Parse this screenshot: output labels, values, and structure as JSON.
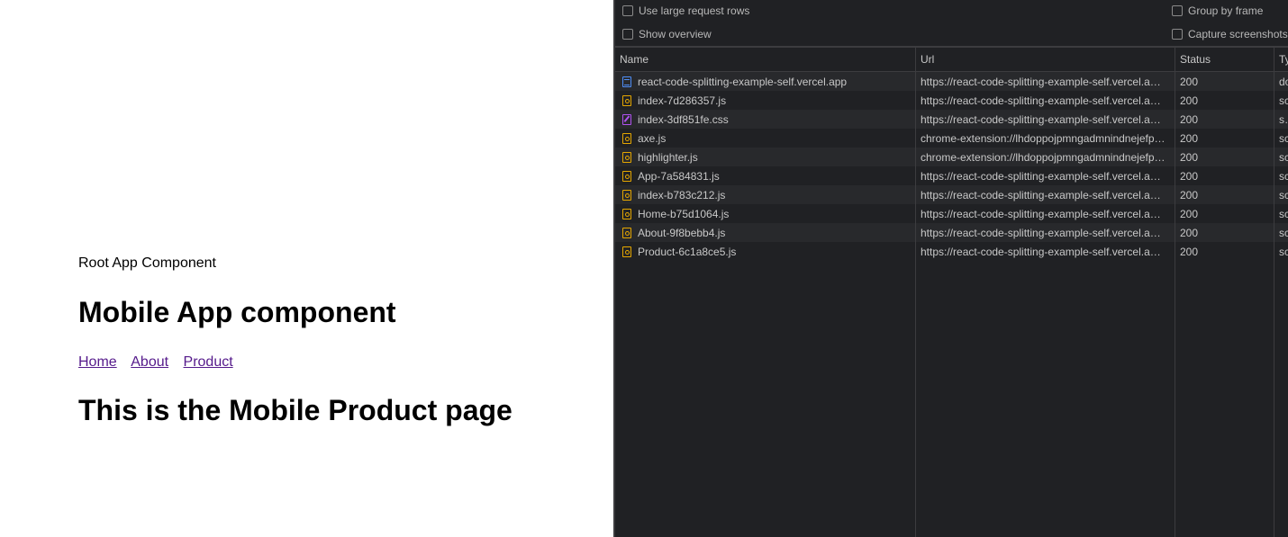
{
  "page": {
    "root_text": "Root App Component",
    "heading": "Mobile App component",
    "nav_links": [
      "Home",
      "About",
      "Product"
    ],
    "page_heading": "This is the Mobile Product page"
  },
  "devtools": {
    "options": {
      "large_rows": "Use large request rows",
      "show_overview": "Show overview",
      "group_by_frame": "Group by frame",
      "capture_screenshots": "Capture screenshots"
    },
    "columns": {
      "name": "Name",
      "url": "Url",
      "status": "Status",
      "type": "Ty"
    },
    "rows": [
      {
        "icon": "doc",
        "name": "react-code-splitting-example-self.vercel.app",
        "url": "https://react-code-splitting-example-self.vercel.a…",
        "status": "200",
        "type": "do"
      },
      {
        "icon": "js",
        "name": "index-7d286357.js",
        "url": "https://react-code-splitting-example-self.vercel.a…",
        "status": "200",
        "type": "sc"
      },
      {
        "icon": "css",
        "name": "index-3df851fe.css",
        "url": "https://react-code-splitting-example-self.vercel.a…",
        "status": "200",
        "type": "sty"
      },
      {
        "icon": "js",
        "name": "axe.js",
        "url": "chrome-extension://lhdoppojpmngadmnindnejefp…",
        "status": "200",
        "type": "sc"
      },
      {
        "icon": "js",
        "name": "highlighter.js",
        "url": "chrome-extension://lhdoppojpmngadmnindnejefp…",
        "status": "200",
        "type": "sc"
      },
      {
        "icon": "js",
        "name": "App-7a584831.js",
        "url": "https://react-code-splitting-example-self.vercel.a…",
        "status": "200",
        "type": "sc"
      },
      {
        "icon": "js",
        "name": "index-b783c212.js",
        "url": "https://react-code-splitting-example-self.vercel.a…",
        "status": "200",
        "type": "sc"
      },
      {
        "icon": "js",
        "name": "Home-b75d1064.js",
        "url": "https://react-code-splitting-example-self.vercel.a…",
        "status": "200",
        "type": "sc"
      },
      {
        "icon": "js",
        "name": "About-9f8bebb4.js",
        "url": "https://react-code-splitting-example-self.vercel.a…",
        "status": "200",
        "type": "sc"
      },
      {
        "icon": "js",
        "name": "Product-6c1a8ce5.js",
        "url": "https://react-code-splitting-example-self.vercel.a…",
        "status": "200",
        "type": "sc"
      }
    ]
  }
}
